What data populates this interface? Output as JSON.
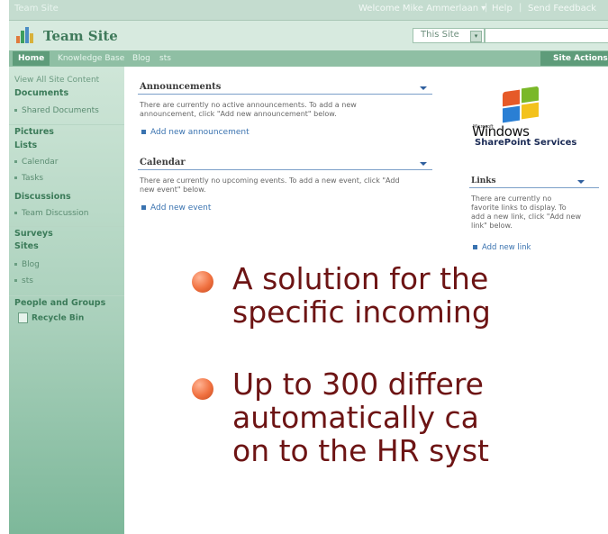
{
  "topbar": {
    "site_link": "Team Site",
    "welcome": "Welcome Mike Ammerlaan ▾",
    "separator": "|",
    "help": "Help",
    "send_feedback": "Send Feedback"
  },
  "header": {
    "title": "Team Site",
    "search_scope": "This Site",
    "scope_arrow": "▾"
  },
  "nav": {
    "tabs": [
      {
        "label": "Home"
      },
      {
        "label": "Knowledge Base"
      },
      {
        "label": "Blog"
      },
      {
        "label": "sts"
      }
    ],
    "site_actions": "Site Actions ▾"
  },
  "quicklaunch": {
    "view_all": "View All Site Content",
    "documents": "Documents",
    "shared_documents": "Shared Documents",
    "pictures": "Pictures",
    "lists": "Lists",
    "calendar": "Calendar",
    "tasks": "Tasks",
    "discussions": "Discussions",
    "team_discussion": "Team Discussion",
    "surveys": "Surveys",
    "sites": "Sites",
    "blog": "Blog",
    "sts": "sts",
    "people_groups": "People and Groups",
    "recycle_bin": "Recycle Bin"
  },
  "announcements": {
    "title": "Announcements",
    "line1": "There are currently no active announcements. To add a new",
    "line2": "announcement, click \"Add new announcement\" below.",
    "add": "Add new announcement"
  },
  "calendar": {
    "title": "Calendar",
    "line1": "There are currently no upcoming events. To add a new event, click \"Add",
    "line2": "new event\" below.",
    "add": "Add new event"
  },
  "logo": {
    "microsoft": "Microsoft",
    "windows": "Windows",
    "sharepoint": "SharePoint Services"
  },
  "links": {
    "title": "Links",
    "line1": "There are currently no",
    "line2": "favorite links to display. To",
    "line3": "add a new link, click \"Add new",
    "line4": "link\" below.",
    "add": "Add new link"
  },
  "overlay": {
    "bullet1_line1": "A solution for the",
    "bullet1_line2": "specific incoming",
    "bullet2_line1": "Up to 300 differe",
    "bullet2_line2": "automatically ca",
    "bullet2_line3": "on to the HR syst"
  },
  "colors": {
    "brand_green": "#5e9c7a",
    "bullet_text": "#6d1414",
    "bullet_orange": "#f0703f",
    "link_blue": "#3a73b0"
  }
}
